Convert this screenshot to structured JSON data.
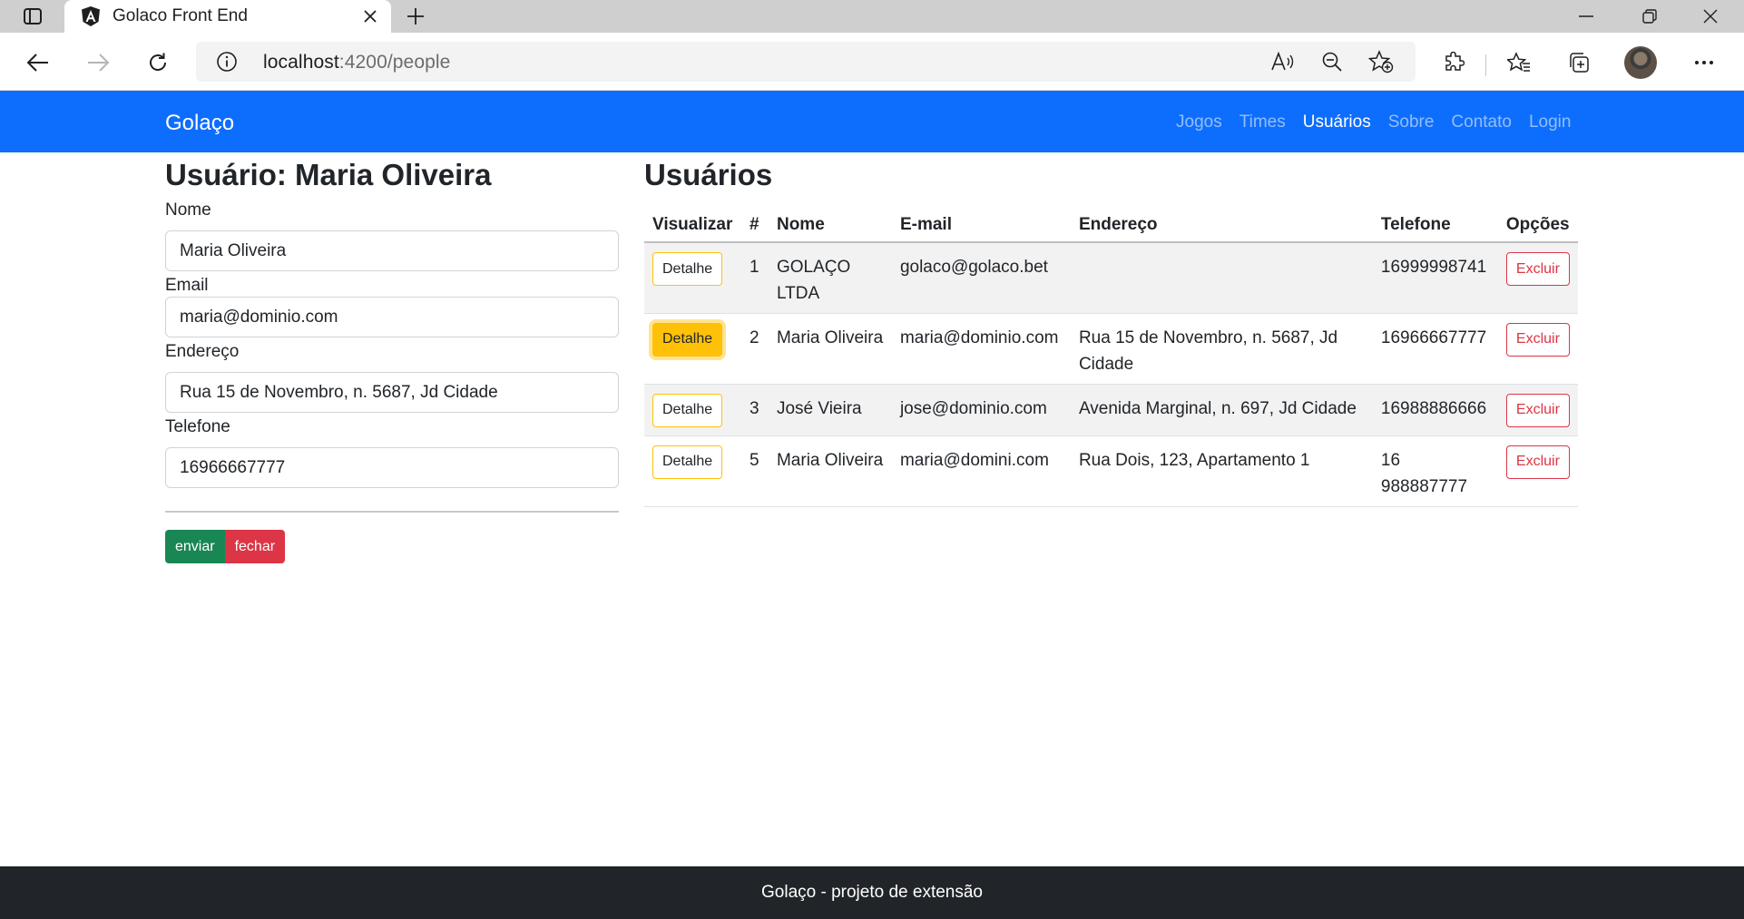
{
  "browser": {
    "tab_title": "Golaco Front End",
    "url_host": "localhost",
    "url_rest": ":4200/people"
  },
  "navbar": {
    "brand": "Golaço",
    "links": [
      "Jogos",
      "Times",
      "Usuários",
      "Sobre",
      "Contato",
      "Login"
    ],
    "active": "Usuários"
  },
  "form": {
    "title": "Usuário: Maria Oliveira",
    "name_label": "Nome",
    "name_value": "Maria Oliveira",
    "email_label": "Email",
    "email_value": "maria@dominio.com",
    "address_label": "Endereço",
    "address_value": "Rua 15 de Novembro, n. 5687, Jd Cidade",
    "phone_label": "Telefone",
    "phone_value": "16966667777",
    "send_label": "enviar",
    "close_label": "fechar"
  },
  "users_table": {
    "title": "Usuários",
    "columns": [
      "Visualizar",
      "#",
      "Nome",
      "E-mail",
      "Endereço",
      "Telefone",
      "Opções"
    ],
    "detail_label": "Detalhe",
    "delete_label": "Excluir",
    "rows": [
      {
        "id": "1",
        "name": "GOLAÇO LTDA",
        "email": "golaco@golaco.bet",
        "address": "",
        "phone": "16999998741",
        "selected": false
      },
      {
        "id": "2",
        "name": "Maria Oliveira",
        "email": "maria@dominio.com",
        "address": "Rua 15 de Novembro, n. 5687, Jd Cidade",
        "phone": "16966667777",
        "selected": true
      },
      {
        "id": "3",
        "name": "José Vieira",
        "email": "jose@dominio.com",
        "address": "Avenida Marginal, n. 697, Jd Cidade",
        "phone": "16988886666",
        "selected": false
      },
      {
        "id": "5",
        "name": "Maria Oliveira",
        "email": "maria@domini.com",
        "address": "Rua Dois, 123, Apartamento 1",
        "phone": "16 988887777",
        "selected": false
      }
    ]
  },
  "footer": {
    "text": "Golaço - projeto de extensão"
  },
  "colors": {
    "primary": "#0d6efd",
    "success": "#198754",
    "danger": "#dc3545",
    "warning": "#ffc107",
    "footer_bg": "#212529"
  }
}
